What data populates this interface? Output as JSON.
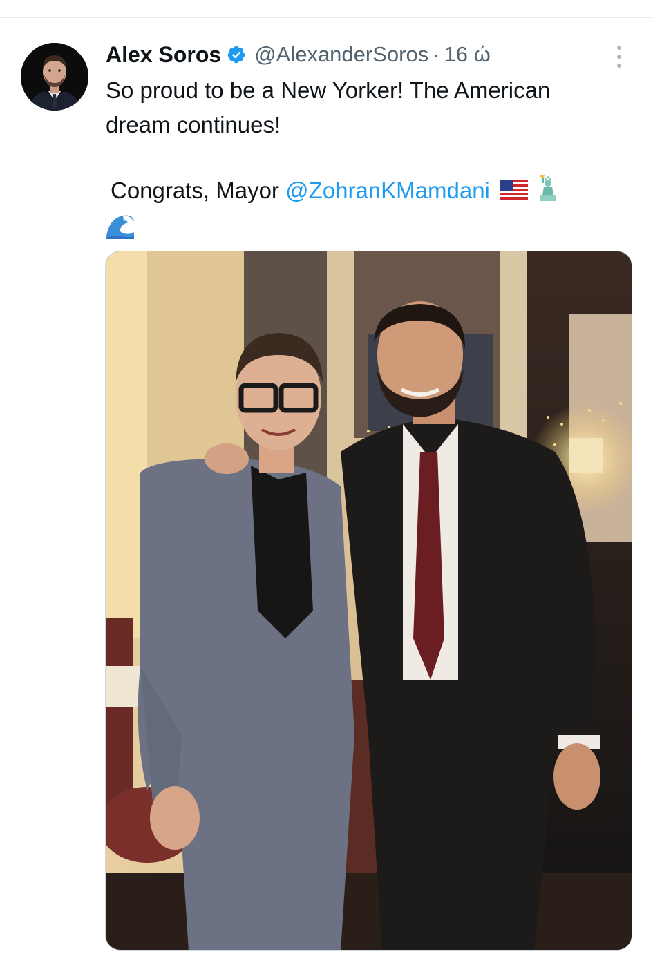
{
  "tweet": {
    "author_name": "Alex Soros",
    "handle": "@AlexanderSoros",
    "separator": "·",
    "time": "16 ώ",
    "text_line1": "So proud to be a New Yorker! The American",
    "text_line2": "dream continues!",
    "congrats_prefix": "Congrats, Mayor ",
    "mention": "@ZohranKMamdani"
  },
  "icons": {
    "verified": "verified-badge-icon",
    "more": "more-options-icon",
    "flag": "us-flag-emoji",
    "statue": "statue-of-liberty-emoji",
    "wave": "water-wave-emoji"
  },
  "colors": {
    "text": "#0f1419",
    "secondary": "#536471",
    "link": "#1d9bf0",
    "verified": "#1d9bf0"
  }
}
